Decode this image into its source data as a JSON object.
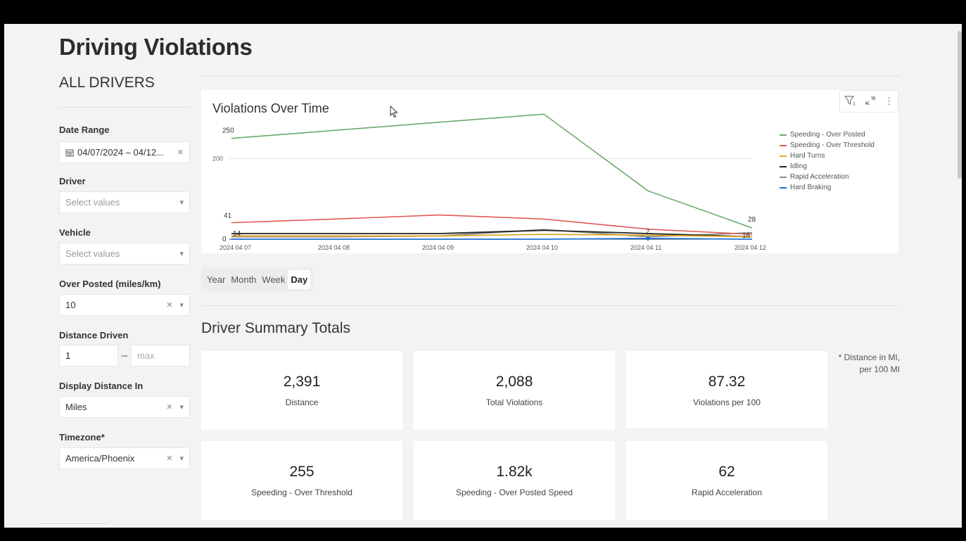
{
  "page": {
    "title": "Driving Violations"
  },
  "sidebar": {
    "title": "ALL DRIVERS",
    "filters": {
      "date_range": {
        "label": "Date Range",
        "value": "04/07/2024 – 04/12..."
      },
      "driver": {
        "label": "Driver",
        "placeholder": "Select values"
      },
      "vehicle": {
        "label": "Vehicle",
        "placeholder": "Select values"
      },
      "over_posted": {
        "label": "Over Posted (miles/km)",
        "value": "10"
      },
      "distance_driven": {
        "label": "Distance Driven",
        "min": "1",
        "max_placeholder": "max"
      },
      "display_distance": {
        "label": "Display Distance In",
        "value": "Miles"
      },
      "timezone": {
        "label": "Timezone*",
        "value": "America/Phoenix"
      }
    }
  },
  "chart": {
    "title": "Violations Over Time",
    "y_tick": "200",
    "data_labels": {
      "first_green": "250",
      "first_red": "41",
      "last_green": "28",
      "mid_label": "2",
      "zero_label": "0",
      "low_label": "14",
      "end_label": "16"
    },
    "legend": [
      {
        "name": "Speeding - Over Posted",
        "color": "#6aa96a"
      },
      {
        "name": "Speeding - Over Threshold",
        "color": "#e05a55"
      },
      {
        "name": "Hard Turns",
        "color": "#e0a526"
      },
      {
        "name": "Idling",
        "color": "#222222"
      },
      {
        "name": "Rapid Acceleration",
        "color": "#8a8a8a"
      },
      {
        "name": "Hard Braking",
        "color": "#1f6fd6"
      }
    ]
  },
  "chart_data": {
    "type": "line",
    "title": "Violations Over Time",
    "xlabel": "",
    "ylabel": "",
    "categories": [
      "2024 04 07",
      "2024 04 08",
      "2024 04 09",
      "2024 04 10",
      "2024 04 11",
      "2024 04 12"
    ],
    "ylim": [
      0,
      300
    ],
    "y_ticks": [
      200
    ],
    "grid": true,
    "legend_position": "right",
    "series": [
      {
        "name": "Speeding - Over Posted",
        "color": "#6aa96a",
        "values": [
          250,
          270,
          290,
          310,
          120,
          28
        ]
      },
      {
        "name": "Speeding - Over Threshold",
        "color": "#e05a55",
        "values": [
          41,
          50,
          60,
          50,
          25,
          12
        ]
      },
      {
        "name": "Hard Turns",
        "color": "#e0a526",
        "values": [
          8,
          8,
          8,
          12,
          10,
          6
        ]
      },
      {
        "name": "Idling",
        "color": "#222222",
        "values": [
          14,
          14,
          14,
          22,
          14,
          6
        ]
      },
      {
        "name": "Rapid Acceleration",
        "color": "#8a8a8a",
        "values": [
          6,
          6,
          8,
          24,
          6,
          16
        ]
      },
      {
        "name": "Hard Braking",
        "color": "#1f6fd6",
        "values": [
          0,
          0,
          0,
          0,
          2,
          0
        ]
      }
    ]
  },
  "granularity": {
    "options": [
      "Year",
      "Month",
      "Week",
      "Day"
    ],
    "selected": "Day"
  },
  "summary": {
    "title": "Driver Summary Totals",
    "note": "* Distance in MI, per 100 MI",
    "stats": [
      {
        "value": "2,391",
        "label": "Distance"
      },
      {
        "value": "2,088",
        "label": "Total Violations"
      },
      {
        "value": "87.32",
        "label": "Violations per 100"
      },
      {
        "value": "255",
        "label": "Speeding - Over Threshold"
      },
      {
        "value": "1.82k",
        "label": "Speeding - Over Posted Speed"
      },
      {
        "value": "62",
        "label": "Rapid Acceleration"
      }
    ]
  }
}
